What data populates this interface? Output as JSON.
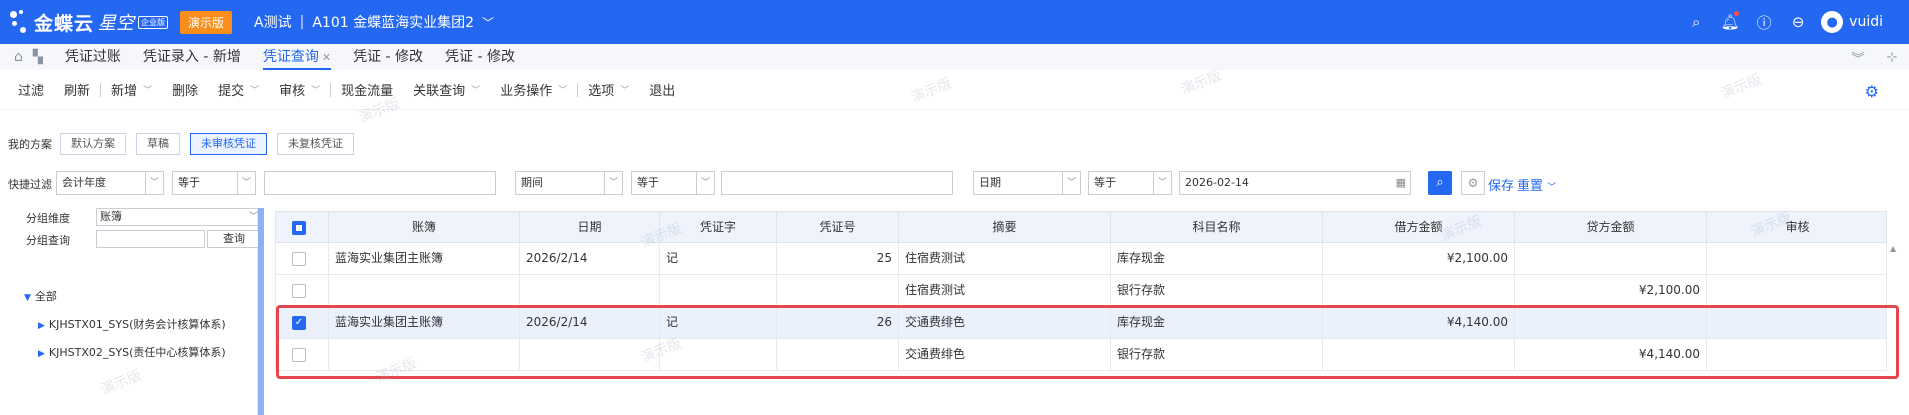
{
  "topbar": {
    "logo_text": "金蝶云",
    "logo_sub": "星空",
    "logo_badge": "企业版",
    "demo_label": "演示版",
    "tenant": "A测试",
    "org": "A101 金蝶蓝海实业集团2",
    "user": "vuidi",
    "bg_color": "#2468f2"
  },
  "tabs": [
    {
      "label": "凭证过账"
    },
    {
      "label": "凭证录入 - 新增"
    },
    {
      "label": "凭证查询",
      "active": true
    },
    {
      "label": "凭证 - 修改"
    },
    {
      "label": "凭证 - 修改"
    }
  ],
  "toolbar": {
    "filter": "过滤",
    "refresh": "刷新",
    "add": "新增",
    "delete": "删除",
    "submit": "提交",
    "audit": "审核",
    "cashflow": "现金流量",
    "related": "关联查询",
    "business": "业务操作",
    "options": "选项",
    "exit": "退出"
  },
  "scheme": {
    "label": "我的方案",
    "chips": [
      "默认方案",
      "草稿",
      "未审核凭证",
      "未复核凭证"
    ],
    "active_index": 2
  },
  "quick_filter": {
    "label": "快捷过滤",
    "field1": "会计年度",
    "op1": "等于",
    "val1": "",
    "field2": "期间",
    "op2": "等于",
    "val2": "",
    "field3": "日期",
    "op3": "等于",
    "val3": "2026-02-14",
    "save": "保存",
    "reset": "重置"
  },
  "left_panel": {
    "dim_label": "分组维度",
    "dim_value": "账簿",
    "query_label": "分组查询",
    "query_value": "",
    "query_btn": "查询",
    "tree_root": "全部",
    "tree_items": [
      "KJHSTX01_SYS(财务会计核算体系)",
      "KJHSTX02_SYS(责任中心核算体系)"
    ]
  },
  "grid": {
    "columns": [
      "账簿",
      "日期",
      "凭证字",
      "凭证号",
      "摘要",
      "科目名称",
      "借方金额",
      "贷方金额",
      "审核"
    ],
    "rows": [
      {
        "checked": false,
        "book": "蓝海实业集团主账簿",
        "date": "2026/2/14",
        "word": "记",
        "no": "25",
        "summary": "住宿费测试",
        "account": "库存现金",
        "debit": "¥2,100.00",
        "credit": "",
        "audit": ""
      },
      {
        "checked": false,
        "book": "",
        "date": "",
        "word": "",
        "no": "",
        "summary": "住宿费测试",
        "account": "银行存款",
        "debit": "",
        "credit": "¥2,100.00",
        "audit": ""
      },
      {
        "checked": true,
        "book": "蓝海实业集团主账簿",
        "date": "2026/2/14",
        "word": "记",
        "no": "26",
        "summary": "交通费绯色",
        "account": "库存现金",
        "debit": "¥4,140.00",
        "credit": "",
        "audit": ""
      },
      {
        "checked": false,
        "book": "",
        "date": "",
        "word": "",
        "no": "",
        "summary": "交通费绯色",
        "account": "银行存款",
        "debit": "",
        "credit": "¥4,140.00",
        "audit": ""
      }
    ]
  },
  "watermark": "演示版",
  "highlight_color": "#e3464b"
}
